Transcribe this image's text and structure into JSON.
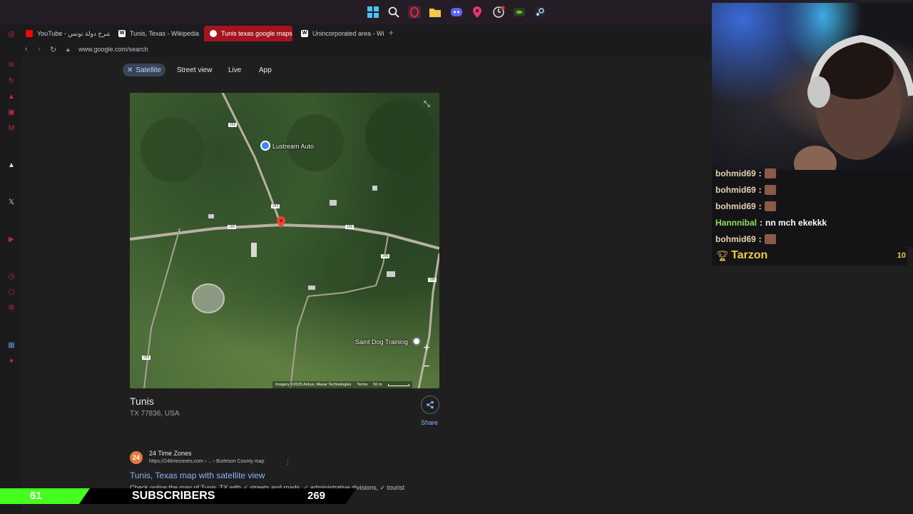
{
  "browser": {
    "tabs": [
      {
        "label": "YouTube - شرح دولة تونس",
        "favicon_color": "#ff0000"
      },
      {
        "label": "Tunis, Texas - Wikipedia",
        "favicon_color": "#ffffff"
      },
      {
        "label": "Tunis texas google maps",
        "favicon_color": "#4285f4"
      },
      {
        "label": "Unincorporated area - Wi",
        "favicon_color": "#ffffff"
      }
    ],
    "new_tab_glyph": "+",
    "url": "www.google.com/search"
  },
  "filters": {
    "satellite": "Satellite",
    "street_view": "Street view",
    "live": "Live",
    "app": "App"
  },
  "map": {
    "labels": {
      "poi_1": "Lustream Auto",
      "poi_2": "Saint Dog Training"
    },
    "road_shields": [
      "252",
      "252",
      "166",
      "166",
      "296",
      "166",
      "253"
    ],
    "attribution": "Imagery ©2025 Airbus, Maxar Technologies",
    "terms": "Terms",
    "scale": "50 m",
    "zoom_in": "+",
    "zoom_out": "−"
  },
  "place": {
    "name": "Tunis",
    "address": "TX 77836, USA",
    "share_label": "Share"
  },
  "result": {
    "logo_text": "24",
    "source_name": "24 Time Zones",
    "source_url": "https://24timezones.com › ... › Burleson County map",
    "title": "Tunis, Texas map with satellite view",
    "description": "Check online the map of Tunis, TX with ✓ streets and roads, ✓ administrative divisions, ✓ tourist"
  },
  "chat": {
    "messages": [
      {
        "user": "bohmid69",
        "sep": ":",
        "text": ""
      },
      {
        "user": "bohmid69",
        "sep": ":",
        "text": ""
      },
      {
        "user": "bohmid69",
        "sep": ":",
        "text": ""
      },
      {
        "user": "Hannnibal",
        "sep": ":",
        "text": "nn mch ekekkk"
      },
      {
        "user": "bohmid69",
        "sep": ":",
        "text": ""
      }
    ],
    "top_user": "Tarzon",
    "top_count": "10"
  },
  "overlay": {
    "sub_count": "61",
    "sub_label": "SUBSCRIBERS",
    "sub_goal": "269"
  },
  "colors": {
    "accent_link": "#8ab4f8",
    "active_tab": "#a3141f",
    "sub_green": "#45ff1e"
  }
}
